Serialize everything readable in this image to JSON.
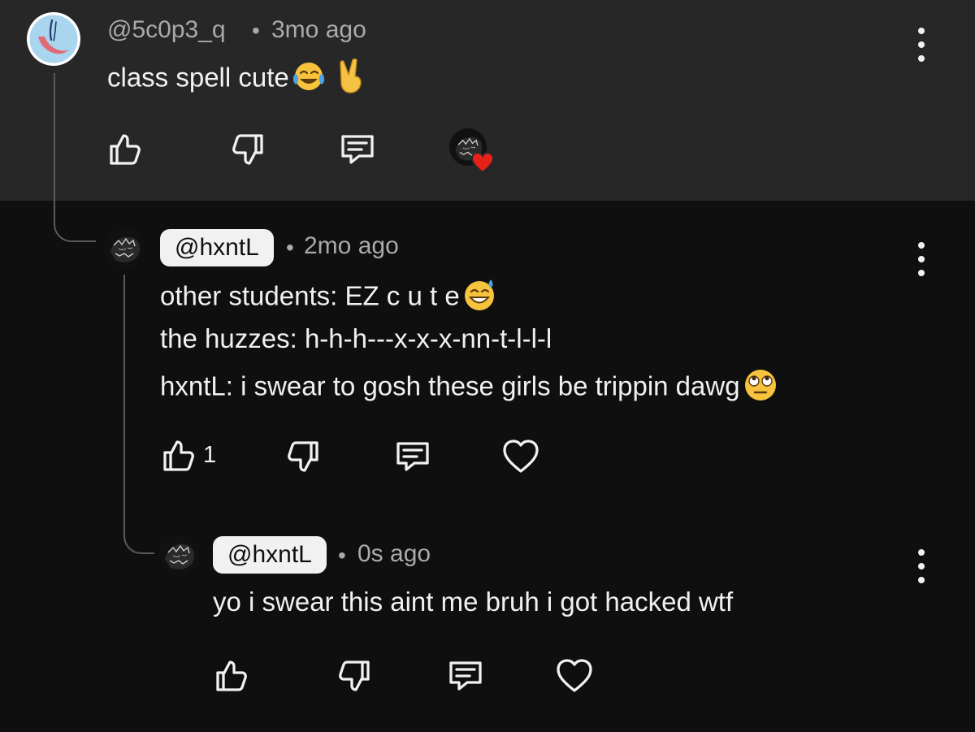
{
  "comment": {
    "handle": "@5c0p3_q",
    "separator": "•",
    "time": "3mo ago",
    "text": "class spell cute",
    "like_count": "",
    "icons": [
      "thumb-up-icon",
      "thumb-down-icon",
      "reply-icon",
      "creator-heart-icon",
      "more-options-icon"
    ]
  },
  "replies": [
    {
      "handle": "@hxntL",
      "separator": "•",
      "time": "2mo ago",
      "lines": [
        "other students: EZ c u t e",
        "the huzzes: h-h-h---x-x-x-nn-t-l-l-l",
        "hxntL: i swear to gosh these girls be trippin dawg"
      ],
      "like_count": "1",
      "icons": [
        "thumb-up-icon",
        "thumb-down-icon",
        "reply-icon",
        "heart-icon",
        "more-options-icon"
      ]
    },
    {
      "handle": "@hxntL",
      "separator": "•",
      "time": "0s ago",
      "text": "yo i swear this aint me bruh i got hacked wtf",
      "like_count": "",
      "icons": [
        "thumb-up-icon",
        "thumb-down-icon",
        "reply-icon",
        "heart-icon",
        "more-options-icon"
      ]
    }
  ],
  "colors": {
    "background": "#0f0f0f",
    "highlight_background": "#272727",
    "text": "#f1f1f1",
    "secondary_text": "#aaaaaa",
    "handle_chip": "#f1f1f1",
    "heart": "#e62117"
  }
}
